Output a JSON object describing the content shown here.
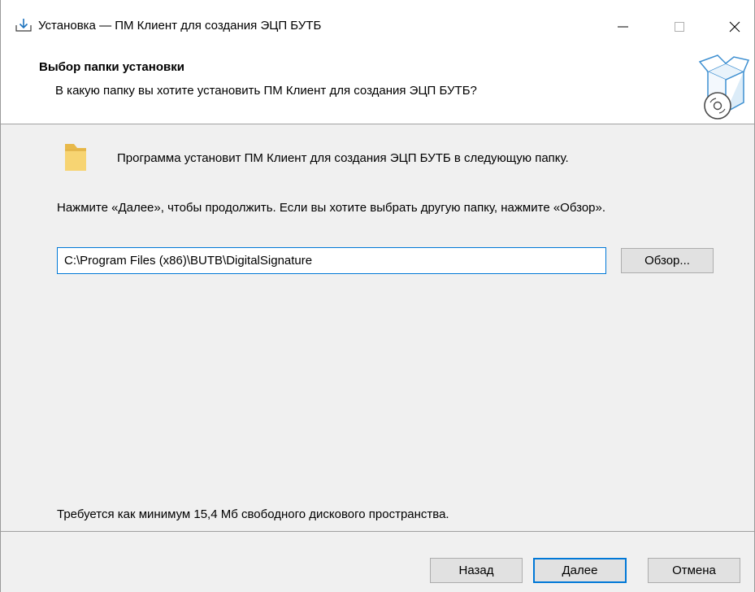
{
  "window": {
    "title": "Установка — ПМ Клиент для создания ЭЦП БУТБ",
    "icon": "install-download-icon",
    "controls": {
      "minimize_icon": "minimize-icon",
      "maximize_icon": "maximize-icon",
      "close_icon": "close-icon"
    }
  },
  "header": {
    "title": "Выбор папки установки",
    "subtitle": "В какую папку вы хотите установить ПМ Клиент для создания ЭЦП БУТБ?",
    "graphic": "setup-box-disc-icon"
  },
  "content": {
    "folder_icon": "folder-icon",
    "folder_text": "Программа установит ПМ Клиент для создания ЭЦП БУТБ в следующую папку.",
    "instructions": "Нажмите «Далее», чтобы продолжить. Если вы хотите выбрать другую папку, нажмите «Обзор».",
    "path_value": "C:\\Program Files (x86)\\BUTB\\DigitalSignature",
    "browse_label": "Обзор...",
    "space_required": "Требуется как минимум 15,4 Мб свободного дискового пространства."
  },
  "footer": {
    "back_label": "Назад",
    "next_label": "Далее",
    "cancel_label": "Отмена"
  },
  "colors": {
    "accent": "#0078d7",
    "button_bg": "#e1e1e1",
    "panel_bg": "#f0f0f0",
    "folder": "#f5cf6b"
  }
}
